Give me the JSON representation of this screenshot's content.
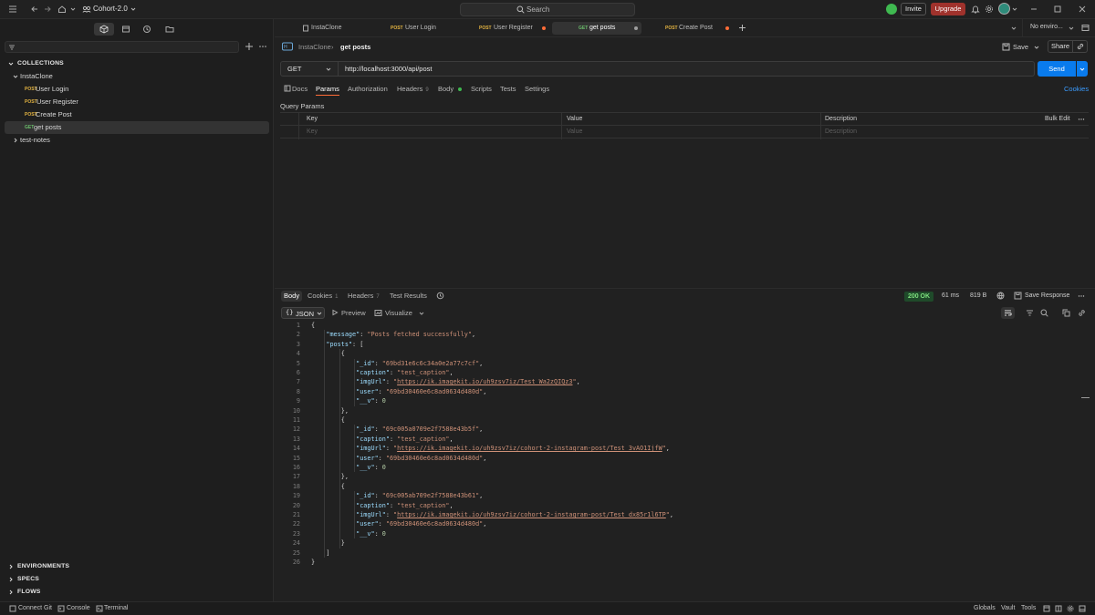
{
  "titlebar": {
    "workspace": "Cohort-2.0",
    "search_placeholder": "Search",
    "invite_label": "Invite",
    "upgrade_label": "Upgrade"
  },
  "sidebar": {
    "collections_title": "COLLECTIONS",
    "collection_name": "InstaClone",
    "items": [
      {
        "method": "POST",
        "label": "User Login"
      },
      {
        "method": "POST",
        "label": "User Register"
      },
      {
        "method": "POST",
        "label": "Create Post"
      },
      {
        "method": "GET",
        "label": "get posts"
      }
    ],
    "other_collection": "test-notes",
    "bottom_sections": [
      "ENVIRONMENTS",
      "SPECS",
      "FLOWS"
    ]
  },
  "tabs": [
    {
      "method": "",
      "label": "InstaClone"
    },
    {
      "method": "POST",
      "label": "User Login"
    },
    {
      "method": "POST",
      "label": "User Register"
    },
    {
      "method": "GET",
      "label": "get posts"
    },
    {
      "method": "POST",
      "label": "Create Post"
    }
  ],
  "environment": "No enviro...",
  "breadcrumb": {
    "collection": "InstaClone",
    "request": "get posts"
  },
  "actions": {
    "save": "Save",
    "share": "Share"
  },
  "request": {
    "method": "GET",
    "url": "http://localhost:3000/api/post",
    "send_label": "Send",
    "cookies_label": "Cookies",
    "subtabs": [
      {
        "label": "Docs"
      },
      {
        "label": "Params"
      },
      {
        "label": "Authorization"
      },
      {
        "label": "Headers",
        "count": "9"
      },
      {
        "label": "Body"
      },
      {
        "label": "Scripts"
      },
      {
        "label": "Tests"
      },
      {
        "label": "Settings"
      }
    ]
  },
  "query_params": {
    "title": "Query Params",
    "headers": [
      "Key",
      "Value",
      "Description"
    ],
    "bulk_edit": "Bulk Edit",
    "placeholders": [
      "Key",
      "Value",
      "Description"
    ]
  },
  "response": {
    "tabs": [
      {
        "label": "Body"
      },
      {
        "label": "Cookies",
        "count": "1"
      },
      {
        "label": "Headers",
        "count": "7"
      },
      {
        "label": "Test Results"
      }
    ],
    "status": "200 OK",
    "time": "61 ms",
    "size": "819 B",
    "save_response": "Save Response",
    "format": "JSON",
    "preview": "Preview",
    "visualize": "Visualize",
    "lines": [
      "{",
      "    \"message\": \"Posts fetched successfully\",",
      "    \"posts\": [",
      "        {",
      "            \"_id\": \"69bd31e6c6c34a0e2a77c7cf\",",
      "            \"caption\": \"test_caption\",",
      "            \"imgUrl\": \"https://ik.imagekit.io/uh9zsv7iz/Test_Wa2zQIQz3\",",
      "            \"user\": \"69bd30460e6c8ad0634d480d\",",
      "            \"__v\": 0",
      "        },",
      "        {",
      "            \"_id\": \"69c005a0709e2f7588e43b5f\",",
      "            \"caption\": \"test_caption\",",
      "            \"imgUrl\": \"https://ik.imagekit.io/uh9zsv7iz/cohort-2-instagram-post/Test_3vAO1IjfW\",",
      "            \"user\": \"69bd30460e6c8ad0634d480d\",",
      "            \"__v\": 0",
      "        },",
      "        {",
      "            \"_id\": \"69c005ab709e2f7588e43b61\",",
      "            \"caption\": \"test_caption\",",
      "            \"imgUrl\": \"https://ik.imagekit.io/uh9zsv7iz/cohort-2-instagram-post/Test_dx85r1l6TP\",",
      "            \"user\": \"69bd30460e6c8ad0634d480d\",",
      "            \"__v\": 0",
      "        }",
      "    ]",
      "}"
    ]
  },
  "statusbar": {
    "left": [
      "Connect Git",
      "Console",
      "Terminal"
    ],
    "right": [
      "Globals",
      "Vault",
      "Tools"
    ]
  },
  "colors": {
    "accent_blue": "#097bed",
    "upgrade_red": "#a0322c",
    "post_method": "#e3b341",
    "get_method": "#6bbd6b",
    "unsaved_dot": "#ff6c37"
  }
}
